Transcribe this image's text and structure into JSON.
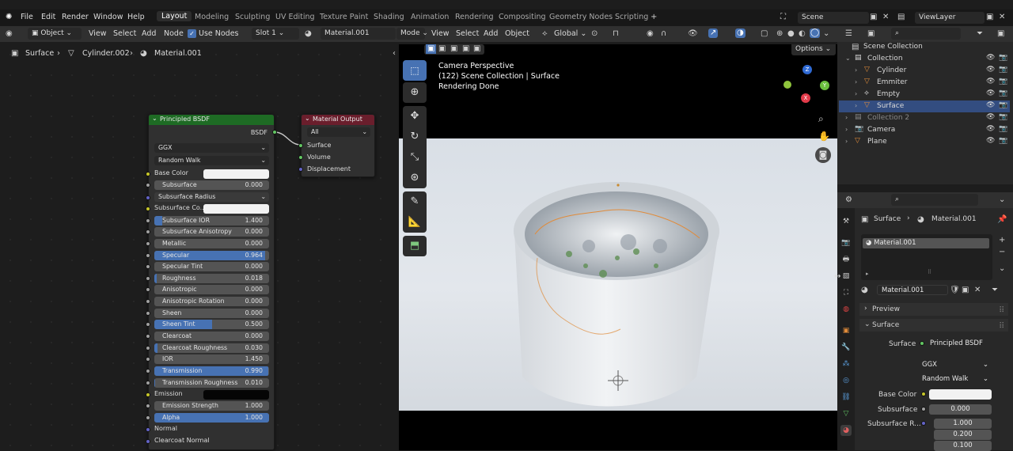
{
  "menu": {
    "file": "File",
    "edit": "Edit",
    "render": "Render",
    "window": "Window",
    "help": "Help"
  },
  "workspaces": [
    "Layout",
    "Modeling",
    "Sculpting",
    "UV Editing",
    "Texture Paint",
    "Shading",
    "Animation",
    "Rendering",
    "Compositing",
    "Geometry Nodes",
    "Scripting"
  ],
  "scene": {
    "label": "Scene",
    "viewlayer": "ViewLayer"
  },
  "node_header": {
    "mode": "Object",
    "view": "View",
    "select": "Select",
    "add": "Add",
    "node": "Node",
    "use_nodes": "Use Nodes",
    "slot": "Slot 1",
    "material": "Material.001"
  },
  "breadcrumb": {
    "obj": "Surface",
    "mesh": "Cylinder.002",
    "mat": "Material.001"
  },
  "viewport_header": {
    "mode": "Mode",
    "view": "View",
    "select": "Select",
    "add": "Add",
    "object": "Object",
    "transform": "Global",
    "options": "Options"
  },
  "viewport_overlay": {
    "line1": "Camera Perspective",
    "line2": "(122) Scene Collection | Surface",
    "line3": "Rendering Done"
  },
  "bsdf": {
    "title": "Principled BSDF",
    "out": "BSDF",
    "distribution": "GGX",
    "subsurface_method": "Random Walk",
    "base_color": "Base Color",
    "subsurface_color": "Subsurface Co...",
    "subsurface_radius": "Subsurface Radius",
    "emission": "Emission",
    "normal": "Normal",
    "clearcoat_normal": "Clearcoat Normal",
    "sliders": [
      {
        "label": "Subsurface",
        "value": "0.000",
        "fill": 0
      },
      {
        "label": "Subsurface IOR",
        "value": "1.400",
        "fill": 0.07
      },
      {
        "label": "Subsurface Anisotropy",
        "value": "0.000",
        "fill": 0
      },
      {
        "label": "Metallic",
        "value": "0.000",
        "fill": 0
      },
      {
        "label": "Specular",
        "value": "0.964",
        "fill": 0.964
      },
      {
        "label": "Specular Tint",
        "value": "0.000",
        "fill": 0
      },
      {
        "label": "Roughness",
        "value": "0.018",
        "fill": 0.018
      },
      {
        "label": "Anisotropic",
        "value": "0.000",
        "fill": 0
      },
      {
        "label": "Anisotropic Rotation",
        "value": "0.000",
        "fill": 0
      },
      {
        "label": "Sheen",
        "value": "0.000",
        "fill": 0
      },
      {
        "label": "Sheen Tint",
        "value": "0.500",
        "fill": 0.5
      },
      {
        "label": "Clearcoat",
        "value": "0.000",
        "fill": 0
      },
      {
        "label": "Clearcoat Roughness",
        "value": "0.030",
        "fill": 0.03
      },
      {
        "label": "IOR",
        "value": "1.450",
        "fill": 0
      },
      {
        "label": "Transmission",
        "value": "0.990",
        "fill": 0.99
      },
      {
        "label": "Transmission Roughness",
        "value": "0.010",
        "fill": 0.01
      }
    ],
    "sliders2": [
      {
        "label": "Emission Strength",
        "value": "1.000",
        "fill": 0
      },
      {
        "label": "Alpha",
        "value": "1.000",
        "fill": 1
      }
    ]
  },
  "matout": {
    "title": "Material Output",
    "target": "All",
    "surface": "Surface",
    "volume": "Volume",
    "displacement": "Displacement"
  },
  "outliner": {
    "scene_collection": "Scene Collection",
    "rows": [
      {
        "label": "Collection",
        "indent": 1
      },
      {
        "label": "Cylinder",
        "indent": 2
      },
      {
        "label": "Emmiter",
        "indent": 2
      },
      {
        "label": "Empty",
        "indent": 2
      },
      {
        "label": "Surface",
        "indent": 2
      },
      {
        "label": "Collection 2",
        "indent": 1
      },
      {
        "label": "Camera",
        "indent": 1
      },
      {
        "label": "Plane",
        "indent": 1
      }
    ]
  },
  "properties": {
    "crumb_obj": "Surface",
    "crumb_mat": "Material.001",
    "slot_name": "Material.001",
    "mat_name": "Material.001",
    "preview": "Preview",
    "surface_panel": "Surface",
    "surface_label": "Surface",
    "surface_value": "Principled BSDF",
    "distribution": "GGX",
    "subsurface_method": "Random Walk",
    "base_color": "Base Color",
    "subsurface": "Subsurface",
    "subsurface_value": "0.000",
    "subsurface_r": "Subsurface R...",
    "radius": [
      "1.000",
      "0.200",
      "0.100"
    ]
  },
  "colors": {
    "accent": "#4772b3",
    "bsdf_header": "#1e6b24",
    "matout_header": "#6a1e2c",
    "selected_row": "#334d80",
    "orange_icon": "#e08b3a",
    "green_icon": "#5fbf62"
  }
}
